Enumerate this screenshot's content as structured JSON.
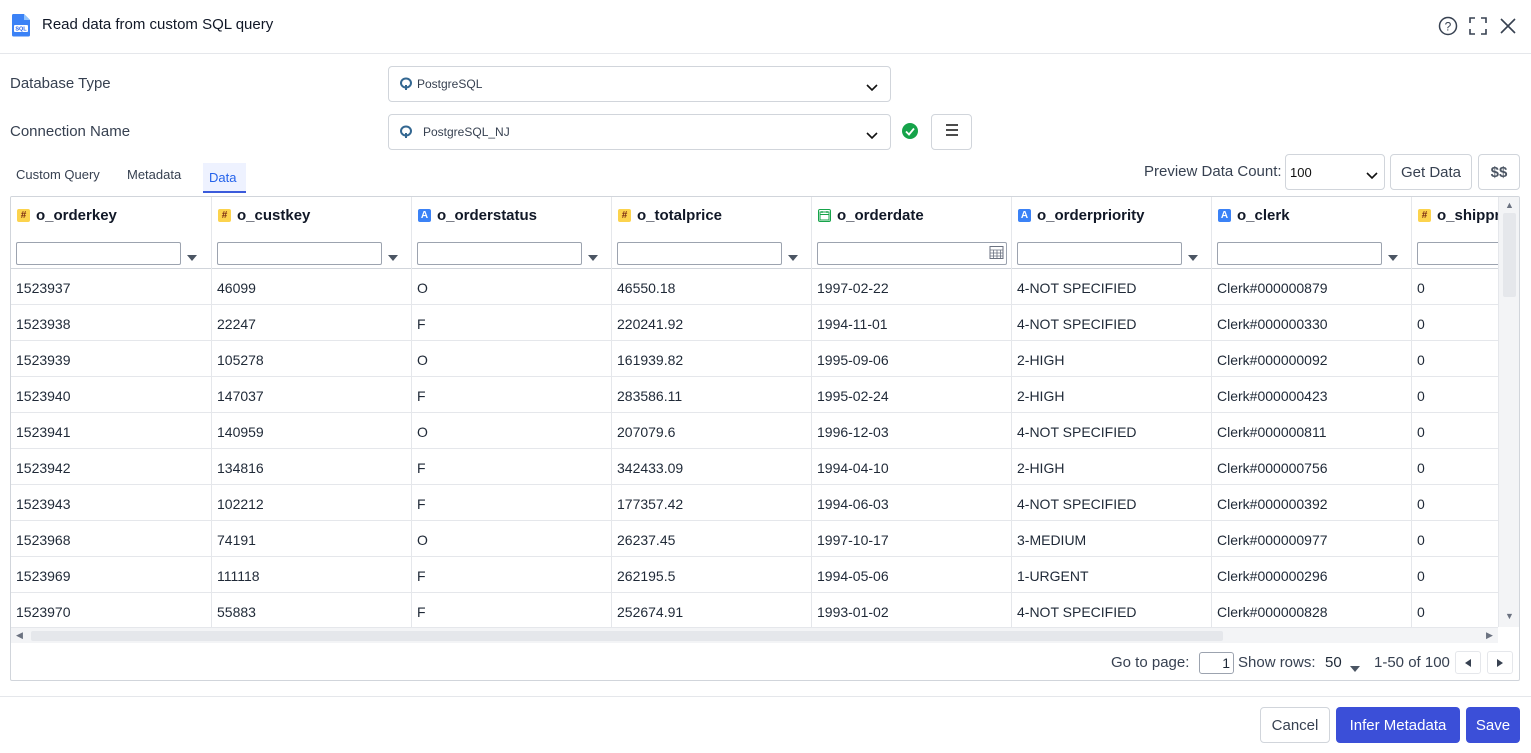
{
  "header": {
    "title": "Read data from custom SQL query",
    "app_icon": "sql-file-icon",
    "icons": [
      "help-icon",
      "fullscreen-icon",
      "close-icon"
    ]
  },
  "form": {
    "database_type": {
      "label": "Database Type",
      "value": "PostgreSQL"
    },
    "connection_name": {
      "label": "Connection Name",
      "value": "PostgreSQL_NJ"
    }
  },
  "tabs": [
    {
      "label": "Custom Query",
      "active": false
    },
    {
      "label": "Metadata",
      "active": false
    },
    {
      "label": "Data",
      "active": true
    }
  ],
  "preview": {
    "label": "Preview Data Count:",
    "value": "100",
    "get_data_label": "Get Data",
    "params_label": "$$"
  },
  "grid": {
    "columns": [
      {
        "name": "o_orderkey",
        "type": "num",
        "type_glyph": "#"
      },
      {
        "name": "o_custkey",
        "type": "num",
        "type_glyph": "#"
      },
      {
        "name": "o_orderstatus",
        "type": "str",
        "type_glyph": "A"
      },
      {
        "name": "o_totalprice",
        "type": "num",
        "type_glyph": "#"
      },
      {
        "name": "o_orderdate",
        "type": "date",
        "type_glyph": "▦"
      },
      {
        "name": "o_orderpriority",
        "type": "str",
        "type_glyph": "A"
      },
      {
        "name": "o_clerk",
        "type": "str",
        "type_glyph": "A"
      },
      {
        "name": "o_shippr",
        "type": "num",
        "type_glyph": "#"
      }
    ],
    "rows": [
      [
        "1523937",
        "46099",
        "O",
        "46550.18",
        "1997-02-22",
        "4-NOT SPECIFIED",
        "Clerk#000000879",
        "0"
      ],
      [
        "1523938",
        "22247",
        "F",
        "220241.92",
        "1994-11-01",
        "4-NOT SPECIFIED",
        "Clerk#000000330",
        "0"
      ],
      [
        "1523939",
        "105278",
        "O",
        "161939.82",
        "1995-09-06",
        "2-HIGH",
        "Clerk#000000092",
        "0"
      ],
      [
        "1523940",
        "147037",
        "F",
        "283586.11",
        "1995-02-24",
        "2-HIGH",
        "Clerk#000000423",
        "0"
      ],
      [
        "1523941",
        "140959",
        "O",
        "207079.6",
        "1996-12-03",
        "4-NOT SPECIFIED",
        "Clerk#000000811",
        "0"
      ],
      [
        "1523942",
        "134816",
        "F",
        "342433.09",
        "1994-04-10",
        "2-HIGH",
        "Clerk#000000756",
        "0"
      ],
      [
        "1523943",
        "102212",
        "F",
        "177357.42",
        "1994-06-03",
        "4-NOT SPECIFIED",
        "Clerk#000000392",
        "0"
      ],
      [
        "1523968",
        "74191",
        "O",
        "26237.45",
        "1997-10-17",
        "3-MEDIUM",
        "Clerk#000000977",
        "0"
      ],
      [
        "1523969",
        "111118",
        "F",
        "262195.5",
        "1994-05-06",
        "1-URGENT",
        "Clerk#000000296",
        "0"
      ],
      [
        "1523970",
        "55883",
        "F",
        "252674.91",
        "1993-01-02",
        "4-NOT SPECIFIED",
        "Clerk#000000828",
        "0"
      ]
    ]
  },
  "pager": {
    "go_to_page_label": "Go to page:",
    "page": "1",
    "show_rows_label": "Show rows:",
    "rows_per_page": "50",
    "range": "1-50 of 100"
  },
  "footer": {
    "cancel_label": "Cancel",
    "infer_label": "Infer Metadata",
    "save_label": "Save"
  },
  "colors": {
    "primary": "#3b4fd8",
    "active_tab": "#2563eb",
    "success": "#16a34a"
  }
}
